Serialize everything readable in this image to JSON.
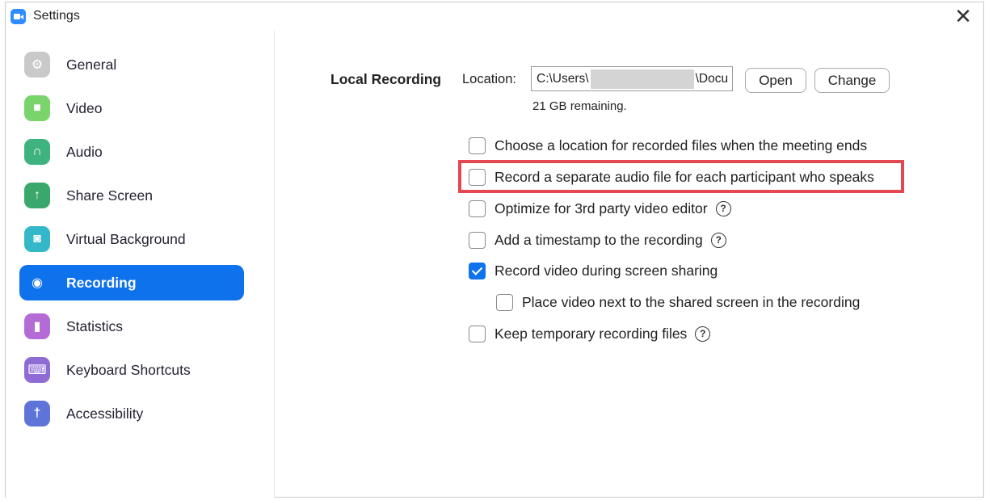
{
  "window": {
    "title": "Settings",
    "close_glyph": "✕"
  },
  "sidebar": {
    "items": [
      {
        "label": "General",
        "icon": "gear-icon",
        "color": "#c9c9c9",
        "glyph": "⚙"
      },
      {
        "label": "Video",
        "icon": "video-camera-icon",
        "color": "#7ad36b",
        "glyph": "■"
      },
      {
        "label": "Audio",
        "icon": "headphones-icon",
        "color": "#3fb37f",
        "glyph": "∩"
      },
      {
        "label": "Share Screen",
        "icon": "share-screen-icon",
        "color": "#3aa86b",
        "glyph": "↑"
      },
      {
        "label": "Virtual Background",
        "icon": "virtual-background-icon",
        "color": "#34b8c9",
        "glyph": "◙"
      },
      {
        "label": "Recording",
        "icon": "record-icon",
        "color": "#0e72ed",
        "glyph": "◉",
        "active": true
      },
      {
        "label": "Statistics",
        "icon": "statistics-icon",
        "color": "#b46bd6",
        "glyph": "▮"
      },
      {
        "label": "Keyboard Shortcuts",
        "icon": "keyboard-icon",
        "color": "#8f6bd6",
        "glyph": "⌨"
      },
      {
        "label": "Accessibility",
        "icon": "accessibility-icon",
        "color": "#5e74d8",
        "glyph": "†"
      }
    ]
  },
  "recording": {
    "section_title": "Local Recording",
    "location_label": "Location:",
    "location_value_start": "C:\\Users\\",
    "location_value_end": "\\Docu",
    "open_button": "Open",
    "change_button": "Change",
    "remaining": "21 GB remaining.",
    "options": [
      {
        "label": "Choose a location for recorded files when the meeting ends",
        "checked": false,
        "help": false
      },
      {
        "label": "Record a separate audio file for each participant who speaks",
        "checked": false,
        "help": false,
        "highlighted": true
      },
      {
        "label": "Optimize for 3rd party video editor",
        "checked": false,
        "help": true
      },
      {
        "label": "Add a timestamp to the recording",
        "checked": false,
        "help": true
      },
      {
        "label": "Record video during screen sharing",
        "checked": true,
        "help": false
      },
      {
        "label": "Place video next to the shared screen in the recording",
        "checked": false,
        "help": false,
        "indent": true
      },
      {
        "label": "Keep temporary recording files",
        "checked": false,
        "help": true
      }
    ],
    "help_glyph": "?",
    "highlight_color": "#e34850",
    "accent_color": "#0e72ed"
  }
}
